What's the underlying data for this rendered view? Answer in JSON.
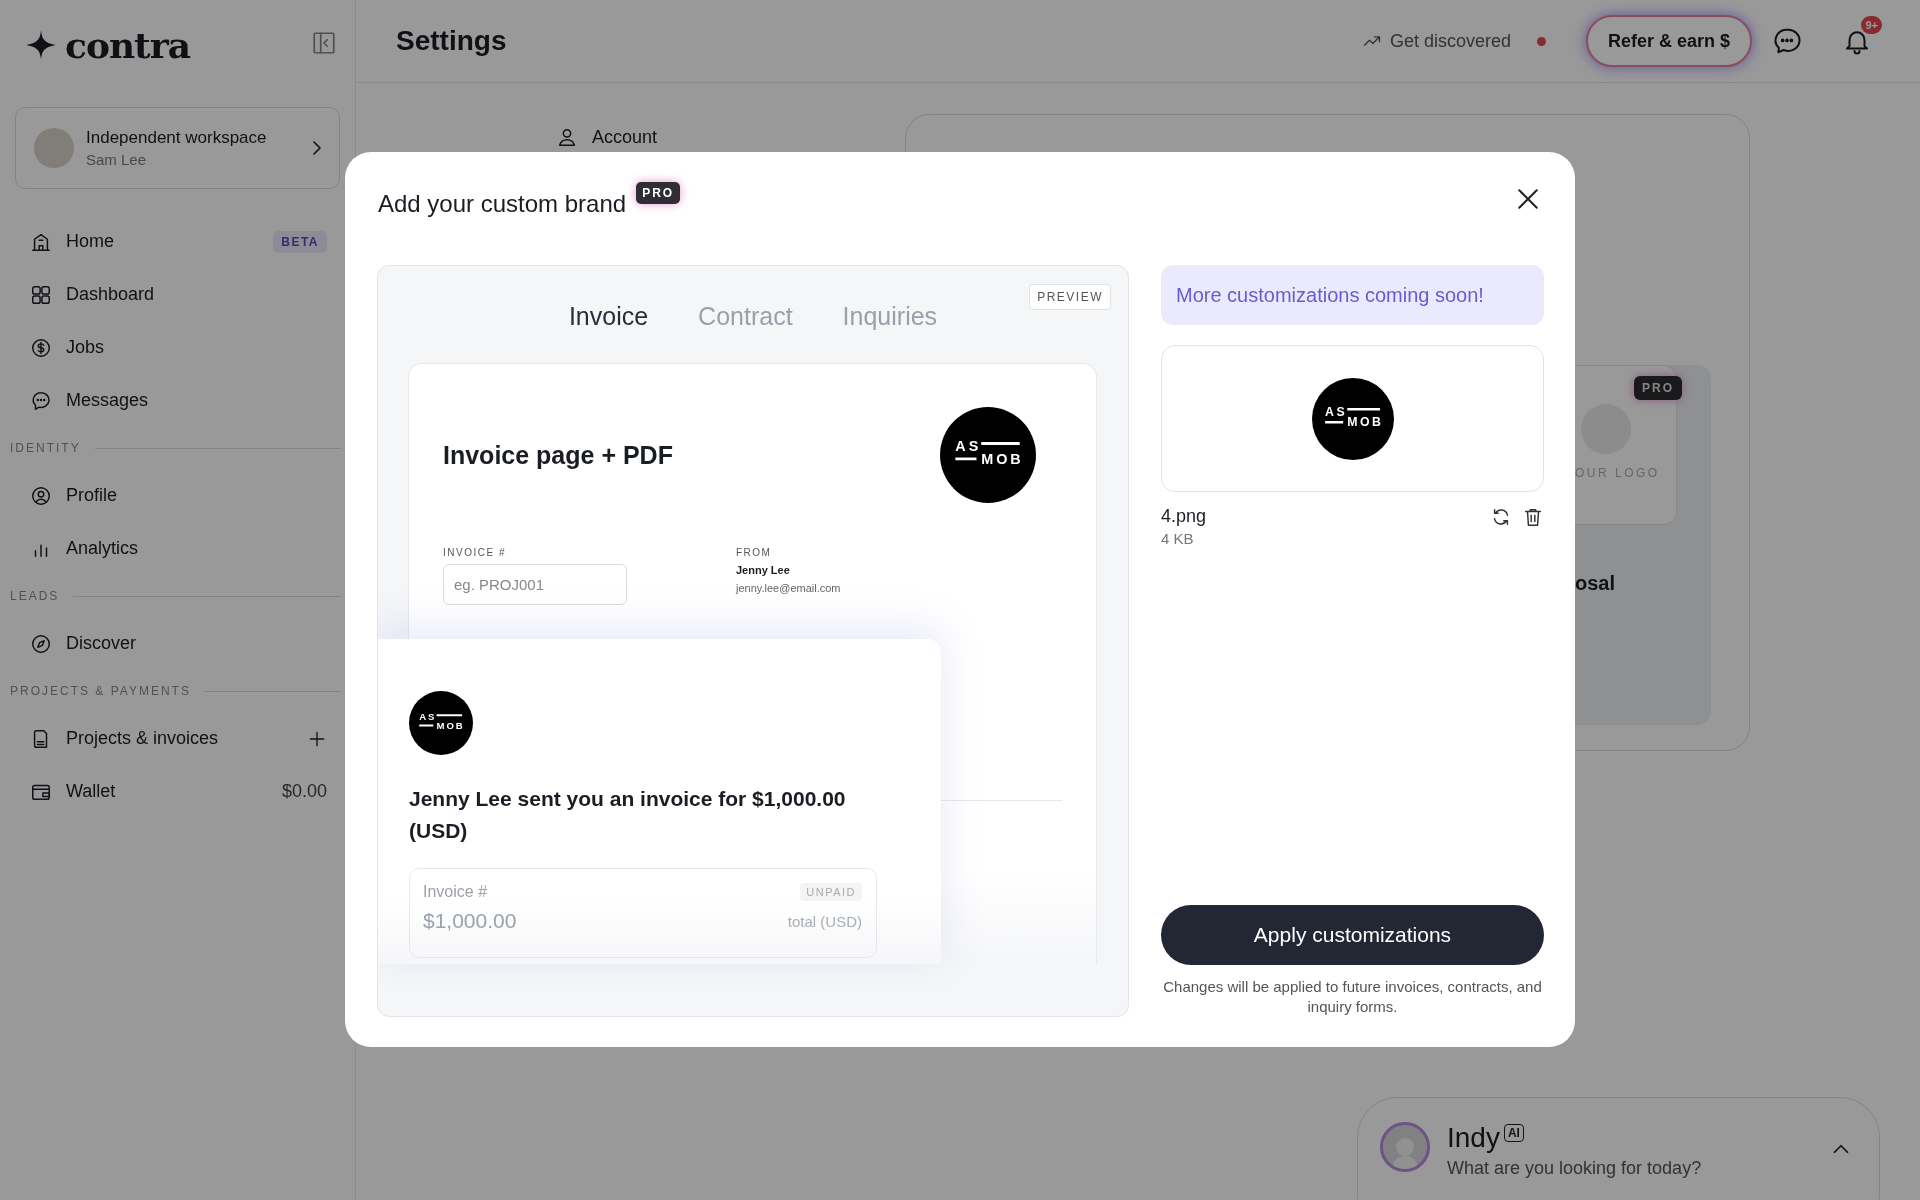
{
  "sidebar": {
    "brand": "contra",
    "workspace": {
      "name": "Independent workspace",
      "owner": "Sam Lee"
    },
    "items": [
      {
        "kind": "link",
        "label": "Home",
        "badge": "BETA"
      },
      {
        "kind": "link",
        "label": "Dashboard"
      },
      {
        "kind": "link",
        "label": "Jobs"
      },
      {
        "kind": "link",
        "label": "Messages"
      },
      {
        "kind": "heading",
        "label": "IDENTITY"
      },
      {
        "kind": "link",
        "label": "Profile"
      },
      {
        "kind": "link",
        "label": "Analytics"
      },
      {
        "kind": "heading",
        "label": "LEADS"
      },
      {
        "kind": "link",
        "label": "Discover"
      },
      {
        "kind": "heading",
        "label": "PROJECTS & PAYMENTS"
      },
      {
        "kind": "add-link",
        "label": "Projects & invoices"
      },
      {
        "kind": "link",
        "label": "Wallet",
        "value": "$0.00"
      }
    ]
  },
  "topbar": {
    "title": "Settings",
    "discover": {
      "label": "Get discovered",
      "alert": true
    },
    "refer_button": "Refer & earn $",
    "notifications": "9+"
  },
  "settings_nav": [
    {
      "label": "Account"
    }
  ],
  "brand_card": {
    "badge": "PRO",
    "logo_caption": "OUR LOGO",
    "title_fragment": "osal"
  },
  "modal": {
    "title": "Add your custom brand",
    "badge": "PRO",
    "tabs": [
      {
        "label": "Invoice",
        "selected": true
      },
      {
        "label": "Contract",
        "selected": false
      },
      {
        "label": "Inquiries",
        "selected": false
      }
    ],
    "preview_badge": "PREVIEW",
    "invoice": {
      "heading": "Invoice page + PDF",
      "logo": {
        "top": "AS",
        "bottom": "MOB"
      },
      "number_label": "INVOICE #",
      "number_placeholder": "eg. PROJ001",
      "from_label": "FROM",
      "from_name": "Jenny Lee",
      "from_email": "jenny.lee@email.com"
    },
    "email": {
      "logo": {
        "top": "AS",
        "bottom": "MOB"
      },
      "message": "Jenny Lee sent you an invoice for $1,000.00 (USD)",
      "number_label": "Invoice #",
      "status": "UNPAID",
      "amount": "$1,000.00",
      "amount_label": "total (USD)"
    },
    "banner": "More customizations coming soon!",
    "upload": {
      "logo": {
        "top": "AS",
        "bottom": "MOB"
      },
      "file_name": "4.png",
      "file_size": "4 KB"
    },
    "apply_button": "Apply customizations",
    "note": "Changes will be applied to future invoices, contracts, and inquiry forms."
  },
  "assistant": {
    "name": "Indy",
    "badge": "AI",
    "prompt": "What are you looking for today?"
  }
}
